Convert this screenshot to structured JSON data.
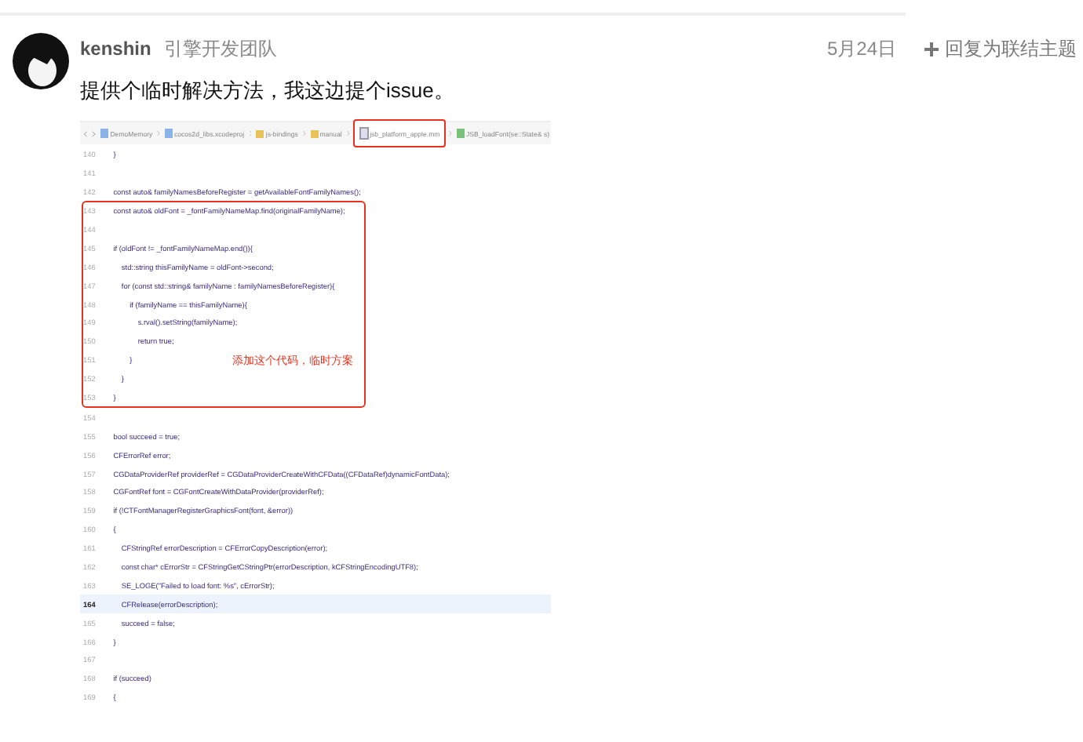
{
  "post": {
    "author": "kenshin",
    "team": "引擎开发团队",
    "date": "5月24日",
    "reply_link": "回复为联结主题",
    "text": "提供个临时解决方法，我这边提个issue。"
  },
  "screenshot": {
    "breadcrumbs": [
      {
        "label": "DemoMemory",
        "kind": "project",
        "boxed": false
      },
      {
        "label": "cocos2d_libs.xcodeproj",
        "kind": "project",
        "boxed": false
      },
      {
        "label": "js-bindings",
        "kind": "folder",
        "boxed": false
      },
      {
        "label": "manual",
        "kind": "folder",
        "boxed": false
      },
      {
        "label": "jsb_platform_apple.mm",
        "kind": "file",
        "boxed": true
      },
      {
        "label": "JSB_loadFont(se::State& s)",
        "kind": "function",
        "boxed": false
      }
    ],
    "lines_before": [
      {
        "number": "140",
        "text": "    }",
        "highlighted": false
      },
      {
        "number": "141",
        "highlighted": false
      },
      {
        "number": "142",
        "text": "    const auto& familyNamesBeforeRegister = getAvailableFontFamilyNames();",
        "highlighted": false
      }
    ],
    "boxed_block": {
      "annotation": "添加这个代码，临时方案",
      "lines": [
        {
          "number": "143",
          "text": "    const auto& oldFont = _fontFamilyNameMap.find(originalFamilyName);",
          "highlighted": false
        },
        {
          "number": "144",
          "highlighted": false
        },
        {
          "number": "145",
          "text": "    if (oldFont != _fontFamilyNameMap.end()){",
          "highlighted": false
        },
        {
          "number": "146",
          "text": "        std::string thisFamilyName = oldFont->second;",
          "highlighted": false
        },
        {
          "number": "147",
          "text": "        for (const std::string& familyName : familyNamesBeforeRegister){",
          "highlighted": false
        },
        {
          "number": "148",
          "text": "            if (familyName == thisFamilyName){",
          "highlighted": false
        },
        {
          "number": "149",
          "text": "                s.rval().setString(familyName);",
          "highlighted": false
        },
        {
          "number": "150",
          "text": "                return true;",
          "highlighted": false
        },
        {
          "number": "151",
          "text": "            }",
          "highlighted": false
        },
        {
          "number": "152",
          "text": "        }",
          "highlighted": false
        },
        {
          "number": "153",
          "text": "    }",
          "highlighted": false
        }
      ]
    },
    "lines_after": [
      {
        "number": "154",
        "highlighted": false
      },
      {
        "number": "155",
        "text": "    bool succeed = true;",
        "highlighted": false
      },
      {
        "number": "156",
        "text": "    CFErrorRef error;",
        "highlighted": false
      },
      {
        "number": "157",
        "text": "    CGDataProviderRef providerRef = CGDataProviderCreateWithCFData((CFDataRef)dynamicFontData);",
        "highlighted": false
      },
      {
        "number": "158",
        "text": "    CGFontRef font = CGFontCreateWithDataProvider(providerRef);",
        "highlighted": false
      },
      {
        "number": "159",
        "text": "    if (!CTFontManagerRegisterGraphicsFont(font, &error))",
        "highlighted": false
      },
      {
        "number": "160",
        "text": "    {",
        "highlighted": false
      },
      {
        "number": "161",
        "text": "        CFStringRef errorDescription = CFErrorCopyDescription(error);",
        "highlighted": false
      },
      {
        "number": "162",
        "text": "        const char* cErrorStr = CFStringGetCStringPtr(errorDescription, kCFStringEncodingUTF8);",
        "highlighted": false
      },
      {
        "number": "163",
        "text": "        SE_LOGE(\"Failed to load font: %s\", cErrorStr);",
        "highlighted": false
      },
      {
        "number": "164",
        "text": "        CFRelease(errorDescription);",
        "highlighted": true
      },
      {
        "number": "165",
        "text": "        succeed = false;",
        "highlighted": false
      },
      {
        "number": "166",
        "text": "    }",
        "highlighted": false
      },
      {
        "number": "167",
        "highlighted": false
      },
      {
        "number": "168",
        "text": "    if (succeed)",
        "highlighted": false
      },
      {
        "number": "169",
        "text": "    {",
        "highlighted": false
      }
    ]
  }
}
